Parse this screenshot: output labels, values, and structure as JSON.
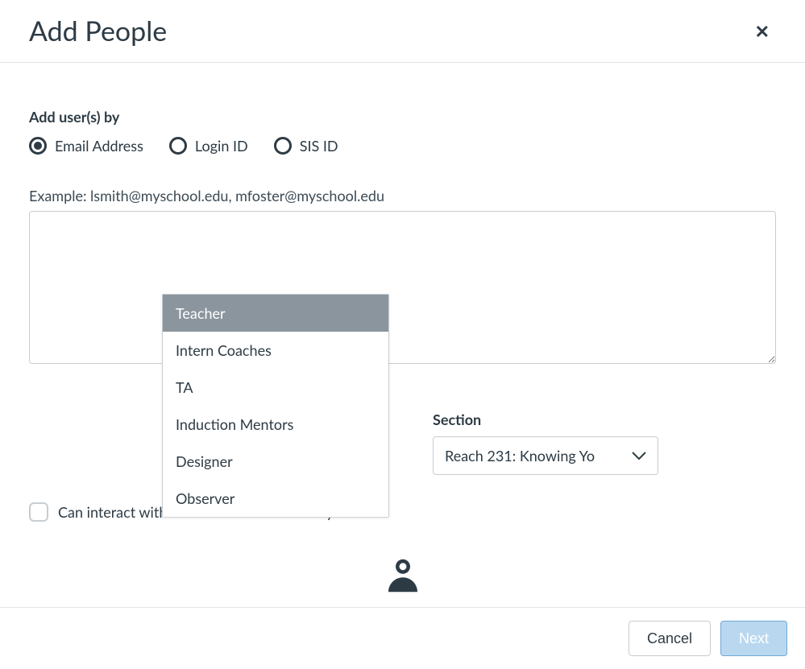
{
  "header": {
    "title": "Add People"
  },
  "addBy": {
    "label": "Add user(s) by",
    "options": [
      {
        "label": "Email Address",
        "selected": true
      },
      {
        "label": "Login ID",
        "selected": false
      },
      {
        "label": "SIS ID",
        "selected": false
      }
    ]
  },
  "example": "Example: lsmith@myschool.edu, mfoster@myschool.edu",
  "textarea": {
    "value": "",
    "placeholder": ""
  },
  "role": {
    "selected": "Teacher",
    "highlighted": "Teacher",
    "options": [
      "Teacher",
      "Intern Coaches",
      "TA",
      "Induction Mentors",
      "Designer",
      "Observer"
    ]
  },
  "section": {
    "label": "Section",
    "selected": "Reach 231: Knowing Yo"
  },
  "checkbox": {
    "label": "Can interact with users in their section only",
    "checked": false
  },
  "footer": {
    "cancel": "Cancel",
    "next": "Next"
  }
}
